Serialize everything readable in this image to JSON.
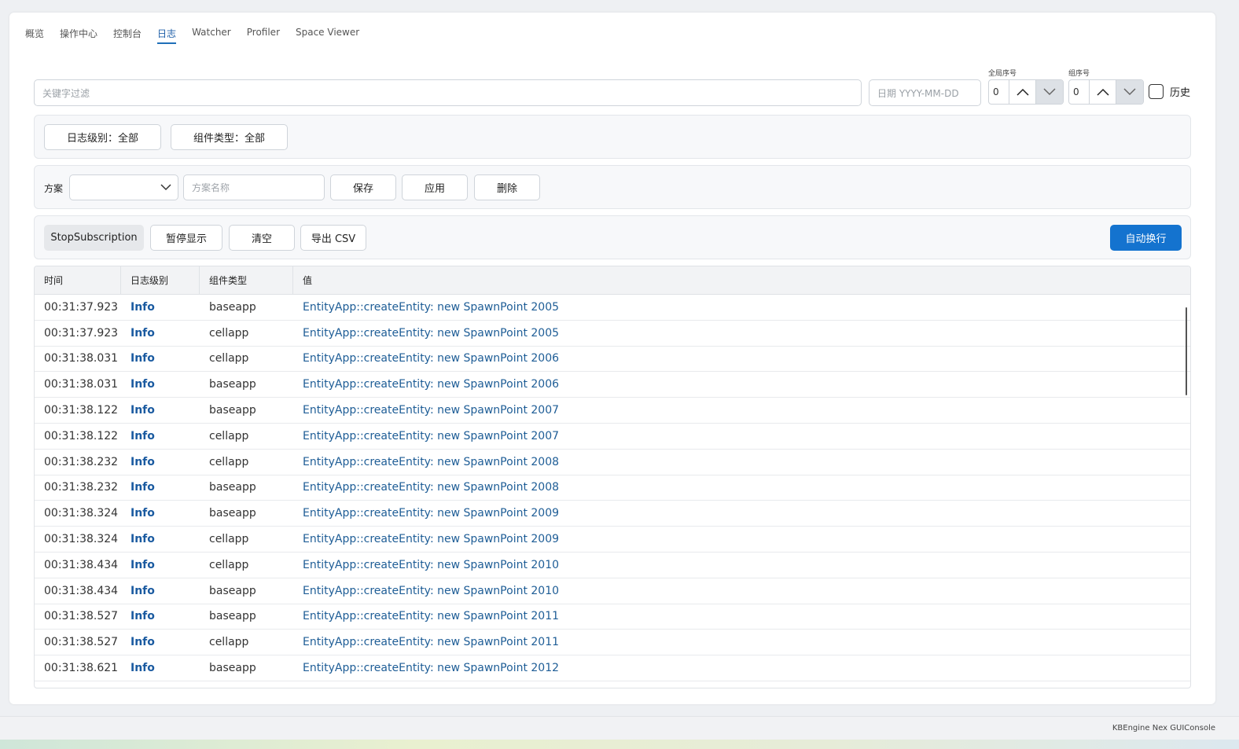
{
  "tabs": [
    {
      "label": "概览"
    },
    {
      "label": "操作中心"
    },
    {
      "label": "控制台"
    },
    {
      "label": "日志"
    },
    {
      "label": "Watcher"
    },
    {
      "label": "Profiler"
    },
    {
      "label": "Space Viewer"
    }
  ],
  "active_tab": "日志",
  "filters": {
    "keyword_placeholder": "关键字过滤",
    "date_placeholder": "日期 YYYY-MM-DD",
    "global_seq_label": "全局序号",
    "global_seq_value": "0",
    "group_seq_label": "组序号",
    "group_seq_value": "0",
    "history_label": "历史"
  },
  "level_panel": {
    "log_level": "日志级别：全部",
    "component_type": "组件类型：全部"
  },
  "scheme_panel": {
    "label": "方案",
    "select_value": "",
    "name_placeholder": "方案名称",
    "save": "保存",
    "apply": "应用",
    "delete": "删除"
  },
  "action_panel": {
    "stop_subscription": "StopSubscription",
    "pause_display": "暂停显示",
    "clear": "清空",
    "export_csv": "导出 CSV",
    "auto_wrap": "自动换行"
  },
  "colors": {
    "accent": "#1473cf",
    "tab_active": "#1f6fb8",
    "level_info": "#1a5aa0",
    "message": "#1e5d96"
  },
  "table": {
    "headers": [
      "时间",
      "日志级别",
      "组件类型",
      "值"
    ],
    "rows": [
      {
        "time": "00:31:37.923",
        "level": "Info",
        "component": "baseapp",
        "message": "EntityApp::createEntity: new SpawnPoint 2005"
      },
      {
        "time": "00:31:37.923",
        "level": "Info",
        "component": "cellapp",
        "message": "EntityApp::createEntity: new SpawnPoint 2005"
      },
      {
        "time": "00:31:38.031",
        "level": "Info",
        "component": "cellapp",
        "message": "EntityApp::createEntity: new SpawnPoint 2006"
      },
      {
        "time": "00:31:38.031",
        "level": "Info",
        "component": "baseapp",
        "message": "EntityApp::createEntity: new SpawnPoint 2006"
      },
      {
        "time": "00:31:38.122",
        "level": "Info",
        "component": "baseapp",
        "message": "EntityApp::createEntity: new SpawnPoint 2007"
      },
      {
        "time": "00:31:38.122",
        "level": "Info",
        "component": "cellapp",
        "message": "EntityApp::createEntity: new SpawnPoint 2007"
      },
      {
        "time": "00:31:38.232",
        "level": "Info",
        "component": "cellapp",
        "message": "EntityApp::createEntity: new SpawnPoint 2008"
      },
      {
        "time": "00:31:38.232",
        "level": "Info",
        "component": "baseapp",
        "message": "EntityApp::createEntity: new SpawnPoint 2008"
      },
      {
        "time": "00:31:38.324",
        "level": "Info",
        "component": "baseapp",
        "message": "EntityApp::createEntity: new SpawnPoint 2009"
      },
      {
        "time": "00:31:38.324",
        "level": "Info",
        "component": "cellapp",
        "message": "EntityApp::createEntity: new SpawnPoint 2009"
      },
      {
        "time": "00:31:38.434",
        "level": "Info",
        "component": "cellapp",
        "message": "EntityApp::createEntity: new SpawnPoint 2010"
      },
      {
        "time": "00:31:38.434",
        "level": "Info",
        "component": "baseapp",
        "message": "EntityApp::createEntity: new SpawnPoint 2010"
      },
      {
        "time": "00:31:38.527",
        "level": "Info",
        "component": "baseapp",
        "message": "EntityApp::createEntity: new SpawnPoint 2011"
      },
      {
        "time": "00:31:38.527",
        "level": "Info",
        "component": "cellapp",
        "message": "EntityApp::createEntity: new SpawnPoint 2011"
      },
      {
        "time": "00:31:38.621",
        "level": "Info",
        "component": "baseapp",
        "message": "EntityApp::createEntity: new SpawnPoint 2012"
      }
    ]
  },
  "footer": {
    "text": "KBEngine Nex GUIConsole"
  }
}
